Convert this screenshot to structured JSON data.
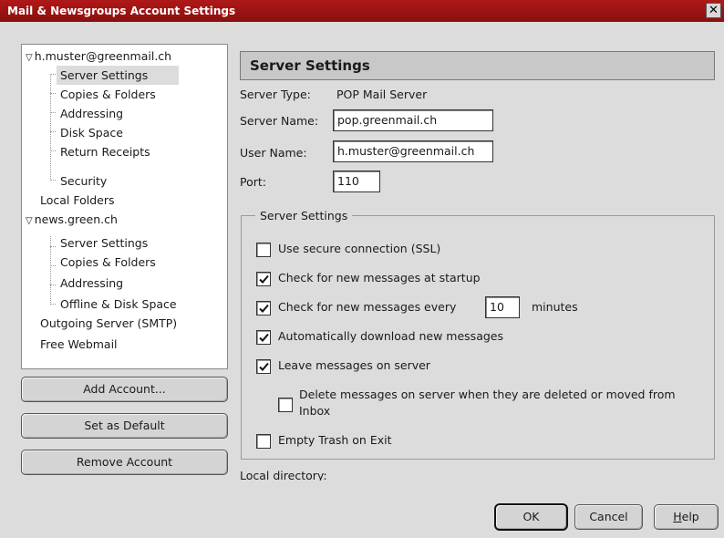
{
  "window": {
    "title": "Mail & Newsgroups Account Settings",
    "close_glyph": "✕"
  },
  "tree": {
    "items": [
      {
        "label": "h.muster@greenmail.ch",
        "expanded": true
      },
      {
        "label": "Server Settings",
        "selected": true
      },
      {
        "label": "Copies & Folders"
      },
      {
        "label": "Addressing"
      },
      {
        "label": "Disk Space"
      },
      {
        "label": "Return Receipts"
      },
      {
        "label": "Security"
      },
      {
        "label": "Local Folders"
      },
      {
        "label": "news.green.ch",
        "expanded": true
      },
      {
        "label": "Server Settings"
      },
      {
        "label": "Copies & Folders"
      },
      {
        "label": "Addressing"
      },
      {
        "label": "Offline & Disk Space"
      },
      {
        "label": "Outgoing Server (SMTP)"
      },
      {
        "label": "Free Webmail"
      }
    ]
  },
  "left_buttons": {
    "add_account": "Add Account...",
    "set_default": "Set as Default",
    "remove_account": "Remove Account"
  },
  "panel": {
    "title": "Server Settings",
    "server_type_label": "Server Type:",
    "server_type_value": "POP Mail Server",
    "server_name_label": "Server Name:",
    "server_name_value": "pop.greenmail.ch",
    "user_name_label": "User Name:",
    "user_name_value": "h.muster@greenmail.ch",
    "port_label": "Port:",
    "port_value": "110"
  },
  "group": {
    "legend": "Server Settings",
    "ssl": {
      "label": "Use secure connection (SSL)",
      "checked": false
    },
    "check_startup": {
      "label": "Check for new messages at startup",
      "checked": true
    },
    "check_every": {
      "label": "Check for new messages every",
      "checked": true,
      "minutes_value": "10",
      "minutes_label": "minutes"
    },
    "auto_download": {
      "label": "Automatically download new messages",
      "checked": true
    },
    "leave_on_server": {
      "label": "Leave messages on server",
      "checked": true
    },
    "delete_on_server": {
      "label_line1": "Delete messages on server when they are deleted or moved from",
      "label_line2": "Inbox",
      "checked": false
    },
    "empty_trash": {
      "label": "Empty Trash on Exit",
      "checked": false
    }
  },
  "local_directory_label": "Local directory:",
  "footer": {
    "ok": "OK",
    "cancel": "Cancel",
    "help_first": "H",
    "help_rest": "elp"
  },
  "colors": {
    "titlebar": "#a01414",
    "window_bg": "#dcdcdc"
  }
}
